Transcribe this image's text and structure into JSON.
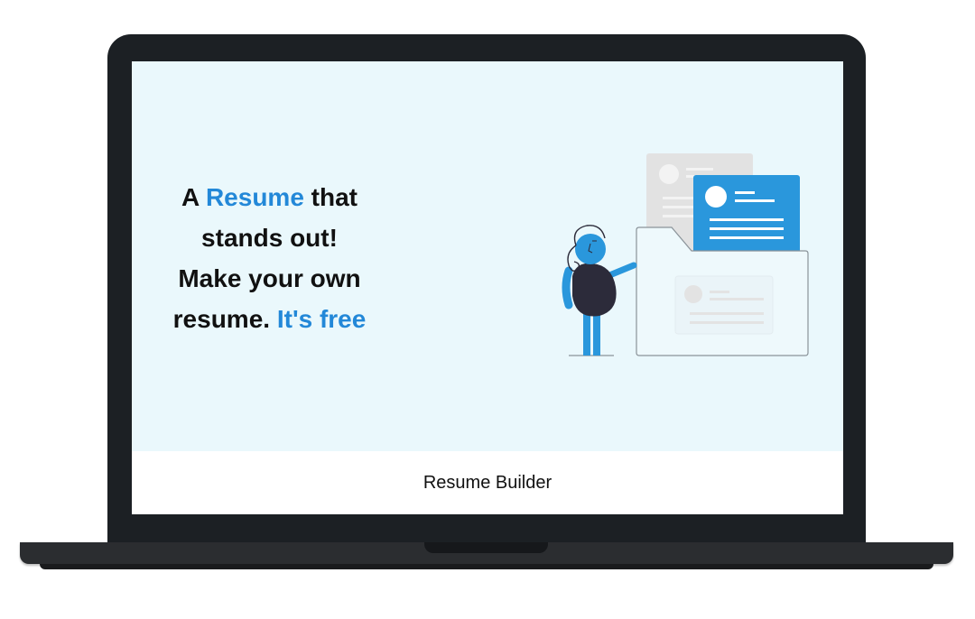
{
  "hero": {
    "line1_a": "A",
    "line1_accent": "Resume",
    "line1_b": "that",
    "line2": "stands out!",
    "line3": "Make your own",
    "line4_a": "resume.",
    "line4_accent": "It's free"
  },
  "footer": {
    "title": "Resume Builder"
  },
  "colors": {
    "accent": "#2388d8",
    "screen_background": "#eaf8fc",
    "laptop_frame": "#1c2024"
  },
  "illustration": {
    "icon": "person-with-resume-documents-illustration"
  }
}
